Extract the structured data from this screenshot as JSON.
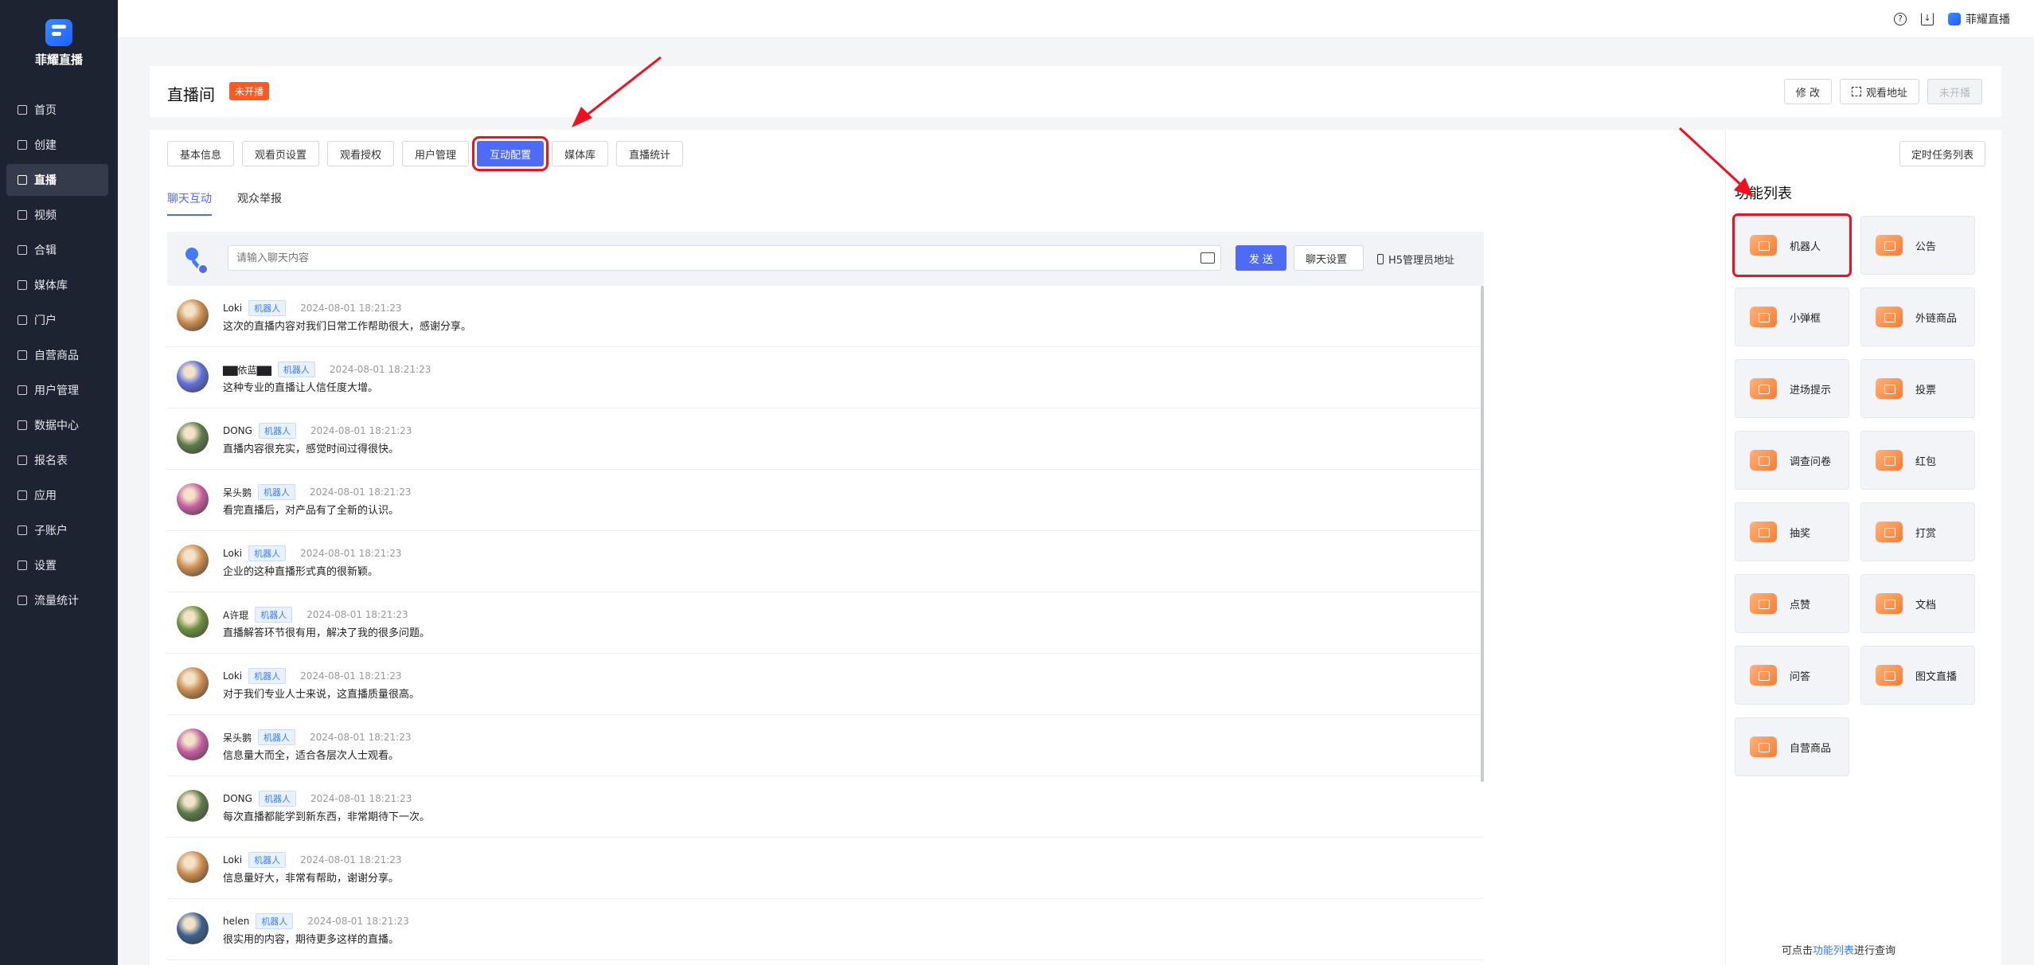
{
  "brand": {
    "name": "菲耀直播"
  },
  "sidebar": {
    "items": [
      {
        "label": "首页"
      },
      {
        "label": "创建"
      },
      {
        "label": "直播"
      },
      {
        "label": "视频"
      },
      {
        "label": "合辑"
      },
      {
        "label": "媒体库"
      },
      {
        "label": "门户"
      },
      {
        "label": "自营商品"
      },
      {
        "label": "用户管理"
      },
      {
        "label": "数据中心"
      },
      {
        "label": "报名表"
      },
      {
        "label": "应用"
      },
      {
        "label": "子账户"
      },
      {
        "label": "设置"
      },
      {
        "label": "流量统计"
      }
    ]
  },
  "topbar": {
    "brand_label": "菲耀直播",
    "help_icon": "question-circle-icon",
    "download_icon": "download-icon"
  },
  "header": {
    "title": "直播间",
    "status": "未开播",
    "edit_label": "修 改",
    "watch_url_label": "观看地址",
    "live_label": "未开播"
  },
  "tabs": {
    "items": [
      {
        "label": "基本信息"
      },
      {
        "label": "观看页设置"
      },
      {
        "label": "观看授权"
      },
      {
        "label": "用户管理"
      },
      {
        "label": "互动配置"
      },
      {
        "label": "媒体库"
      },
      {
        "label": "直播统计"
      }
    ],
    "active": "互动配置",
    "schedule_label": "定时任务列表"
  },
  "subtabs": {
    "items": [
      {
        "label": "聊天互动"
      },
      {
        "label": "观众举报"
      }
    ]
  },
  "chat_bar": {
    "placeholder": "请输入聊天内容",
    "send_label": "发 送",
    "settings_label": "聊天设置",
    "h5_label": "H5管理员地址"
  },
  "messages": [
    {
      "name": "Loki",
      "tag": "机器人",
      "time": "2024-08-01 18:21:23",
      "text": "这次的直播内容对我们日常工作帮助很大，感谢分享。",
      "avatar_color": "#c98b4f"
    },
    {
      "name": "▇▇依蓝▇▇",
      "tag": "机器人",
      "time": "2024-08-01 18:21:23",
      "text": "这种专业的直播让人信任度大增。",
      "avatar_color": "#5f6fd8"
    },
    {
      "name": "DONG",
      "tag": "机器人",
      "time": "2024-08-01 18:21:23",
      "text": "直播内容很充实，感觉时间过得很快。",
      "avatar_color": "#5c7a4a"
    },
    {
      "name": "呆头鹅",
      "tag": "机器人",
      "time": "2024-08-01 18:21:23",
      "text": "看完直播后，对产品有了全新的认识。",
      "avatar_color": "#c45fa0"
    },
    {
      "name": "Loki",
      "tag": "机器人",
      "time": "2024-08-01 18:21:23",
      "text": "企业的这种直播形式真的很新颖。",
      "avatar_color": "#c98b4f"
    },
    {
      "name": "A许琨",
      "tag": "机器人",
      "time": "2024-08-01 18:21:23",
      "text": "直播解答环节很有用，解决了我的很多问题。",
      "avatar_color": "#6a8f3c"
    },
    {
      "name": "Loki",
      "tag": "机器人",
      "time": "2024-08-01 18:21:23",
      "text": "对于我们专业人士来说，这直播质量很高。",
      "avatar_color": "#c98b4f"
    },
    {
      "name": "呆头鹅",
      "tag": "机器人",
      "time": "2024-08-01 18:21:23",
      "text": "信息量大而全，适合各层次人士观看。",
      "avatar_color": "#c45fa0"
    },
    {
      "name": "DONG",
      "tag": "机器人",
      "time": "2024-08-01 18:21:23",
      "text": "每次直播都能学到新东西，非常期待下一次。",
      "avatar_color": "#5c7a4a"
    },
    {
      "name": "Loki",
      "tag": "机器人",
      "time": "2024-08-01 18:21:23",
      "text": "信息量好大，非常有帮助，谢谢分享。",
      "avatar_color": "#c98b4f"
    },
    {
      "name": "helen",
      "tag": "机器人",
      "time": "2024-08-01 18:21:23",
      "text": "很实用的内容，期待更多这样的直播。",
      "avatar_color": "#3c5f8f"
    }
  ],
  "functions": {
    "title": "功能列表",
    "items": [
      {
        "label": "机器人"
      },
      {
        "label": "公告"
      },
      {
        "label": "小弹框"
      },
      {
        "label": "外链商品"
      },
      {
        "label": "进场提示"
      },
      {
        "label": "投票"
      },
      {
        "label": "调查问卷"
      },
      {
        "label": "红包"
      },
      {
        "label": "抽奖"
      },
      {
        "label": "打赏"
      },
      {
        "label": "点赞"
      },
      {
        "label": "文档"
      },
      {
        "label": "问答"
      },
      {
        "label": "图文直播"
      },
      {
        "label": "自营商品"
      }
    ],
    "hint_prefix": "可点击",
    "hint_link": "功能列表",
    "hint_suffix": "进行查询"
  },
  "colors": {
    "accent": "#4f6bf5",
    "highlight": "#f0101f",
    "badge": "#ff5a1f",
    "sidebar_bg": "#1e2331"
  }
}
